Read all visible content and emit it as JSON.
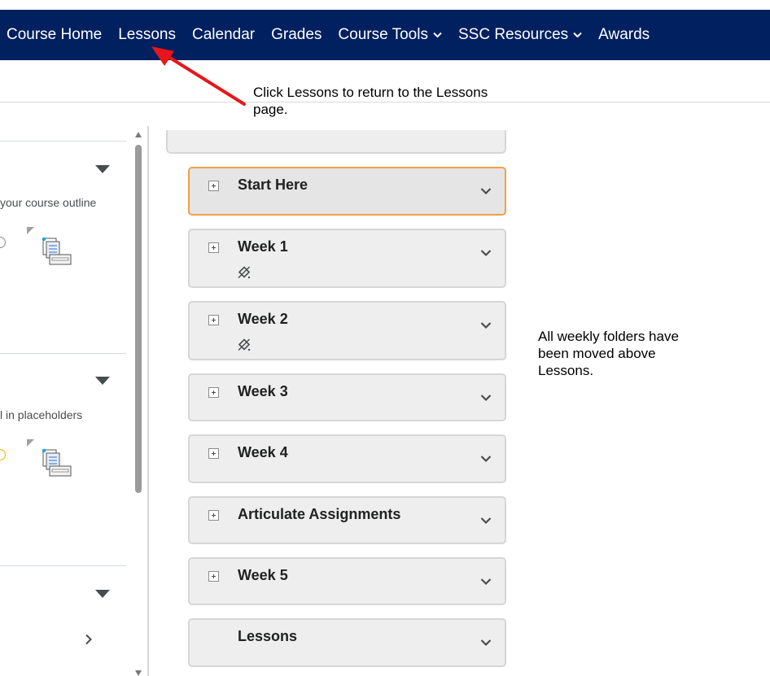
{
  "nav": {
    "items": [
      {
        "label": "Course Home",
        "has_dropdown": false
      },
      {
        "label": "Lessons",
        "has_dropdown": false
      },
      {
        "label": "Calendar",
        "has_dropdown": false
      },
      {
        "label": "Grades",
        "has_dropdown": false
      },
      {
        "label": "Course Tools",
        "has_dropdown": true
      },
      {
        "label": "SSC Resources",
        "has_dropdown": true
      },
      {
        "label": "Awards",
        "has_dropdown": false
      }
    ]
  },
  "annotations": {
    "lessons_note": "Click Lessons to return to the Lessons page.",
    "folders_note": "All weekly folders have been moved above Lessons."
  },
  "left_panel": {
    "widget_1_text": "your course outline",
    "widget_2_text": "l in placeholders"
  },
  "modules": [
    {
      "title": "Start Here",
      "expandable": true,
      "selected": true,
      "has_subicon": false
    },
    {
      "title": "Week 1",
      "expandable": true,
      "selected": false,
      "has_subicon": true
    },
    {
      "title": "Week 2",
      "expandable": true,
      "selected": false,
      "has_subicon": true
    },
    {
      "title": "Week 3",
      "expandable": true,
      "selected": false,
      "has_subicon": false
    },
    {
      "title": "Week 4",
      "expandable": true,
      "selected": false,
      "has_subicon": false
    },
    {
      "title": "Articulate Assignments",
      "expandable": true,
      "selected": false,
      "has_subicon": false
    },
    {
      "title": "Week 5",
      "expandable": true,
      "selected": false,
      "has_subicon": false
    },
    {
      "title": "Lessons",
      "expandable": false,
      "selected": false,
      "has_subicon": false
    }
  ],
  "colors": {
    "navbar": "#002060",
    "selected_border": "#f0a04b",
    "annotation_arrow": "#e8161c"
  },
  "icons": {
    "dropdown": "chevron-down-icon",
    "expand": "plus-box-icon",
    "availability": "release-conditions-icon"
  }
}
